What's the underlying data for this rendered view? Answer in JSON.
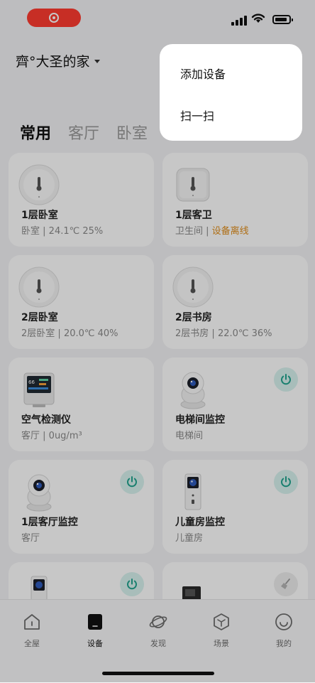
{
  "header": {
    "home_name": "齊°大圣的家"
  },
  "tabs": [
    {
      "label": "常用",
      "active": true
    },
    {
      "label": "客厅",
      "active": false
    },
    {
      "label": "卧室",
      "active": false
    }
  ],
  "devices": [
    {
      "name": "1层卧室",
      "room": "卧室",
      "status": "24.1℃ 25%",
      "offline": false,
      "icon": "thermometer-icon",
      "power": null
    },
    {
      "name": "1层客卫",
      "room": "卫生间",
      "status": "设备离线",
      "offline": true,
      "icon": "thermometer-square-icon",
      "power": null
    },
    {
      "name": "2层卧室",
      "room": "2层卧室",
      "status": "20.0℃ 40%",
      "offline": false,
      "icon": "thermometer-icon",
      "power": null
    },
    {
      "name": "2层书房",
      "room": "2层书房",
      "status": "22.0℃ 36%",
      "offline": false,
      "icon": "thermometer-icon",
      "power": null
    },
    {
      "name": "空气检测仪",
      "room": "客厅",
      "status": "0ug/m³",
      "offline": false,
      "icon": "air-monitor-icon",
      "power": null
    },
    {
      "name": "电梯间监控",
      "room": "电梯间",
      "status": "",
      "offline": false,
      "icon": "camera-icon",
      "power": "on"
    },
    {
      "name": "1层客厅监控",
      "room": "客厅",
      "status": "",
      "offline": false,
      "icon": "camera-icon",
      "power": "on"
    },
    {
      "name": "儿童房监控",
      "room": "儿童房",
      "status": "",
      "offline": false,
      "icon": "door-camera-icon",
      "power": "on"
    }
  ],
  "popup_menu": {
    "add_device": "添加设备",
    "scan": "扫一扫"
  },
  "bottom_nav": [
    {
      "label": "全屋",
      "icon": "house-icon",
      "active": false
    },
    {
      "label": "设备",
      "icon": "device-icon",
      "active": true
    },
    {
      "label": "发现",
      "icon": "planet-icon",
      "active": false
    },
    {
      "label": "场景",
      "icon": "scene-icon",
      "active": false
    },
    {
      "label": "我的",
      "icon": "smiley-icon",
      "active": false
    }
  ],
  "colors": {
    "accent": "#20a48f",
    "warning": "#e08e1b",
    "record": "#ff3b30"
  }
}
